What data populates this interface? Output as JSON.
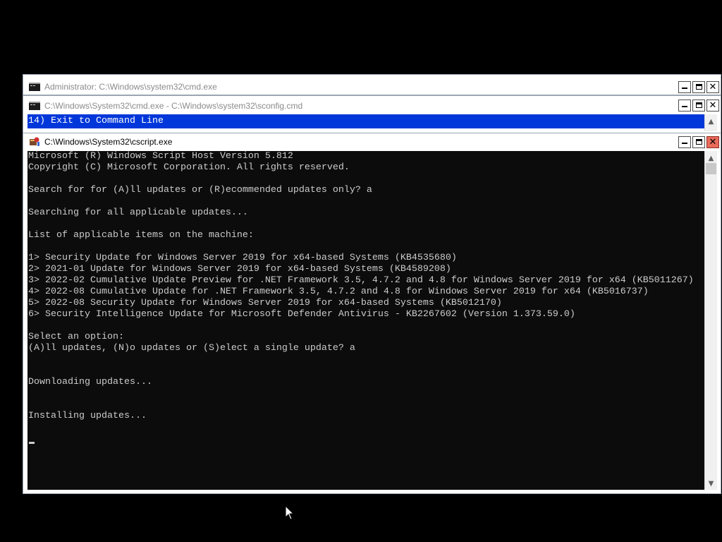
{
  "windows": {
    "admin_cmd": {
      "title": "Administrator: C:\\Windows\\system32\\cmd.exe",
      "icon": "console-icon"
    },
    "sconfig": {
      "title": "C:\\Windows\\System32\\cmd.exe - C:\\Windows\\system32\\sconfig.cmd",
      "icon": "console-icon",
      "selected_line": "14) Exit to Command Line"
    },
    "cscript": {
      "title": "C:\\Windows\\System32\\cscript.exe",
      "icon": "script-host-icon"
    }
  },
  "console_lines": [
    "Microsoft (R) Windows Script Host Version 5.812",
    "Copyright (C) Microsoft Corporation. All rights reserved.",
    "",
    "Search for for (A)ll updates or (R)ecommended updates only? a",
    "",
    "Searching for all applicable updates...",
    "",
    "List of applicable items on the machine:",
    "",
    "1> Security Update for Windows Server 2019 for x64-based Systems (KB4535680)",
    "2> 2021-01 Update for Windows Server 2019 for x64-based Systems (KB4589208)",
    "3> 2022-02 Cumulative Update Preview for .NET Framework 3.5, 4.7.2 and 4.8 for Windows Server 2019 for x64 (KB5011267)",
    "4> 2022-08 Cumulative Update for .NET Framework 3.5, 4.7.2 and 4.8 for Windows Server 2019 for x64 (KB5016737)",
    "5> 2022-08 Security Update for Windows Server 2019 for x64-based Systems (KB5012170)",
    "6> Security Intelligence Update for Microsoft Defender Antivirus - KB2267602 (Version 1.373.59.0)",
    "",
    "Select an option:",
    "(A)ll updates, (N)o updates or (S)elect a single update? a",
    "",
    "",
    "Downloading updates...",
    "",
    "",
    "Installing updates..."
  ],
  "colors": {
    "console_bg": "#0c0c0c",
    "console_fg": "#cccccc",
    "selection_bg": "#0037da",
    "desktop_bg": "#000000"
  }
}
